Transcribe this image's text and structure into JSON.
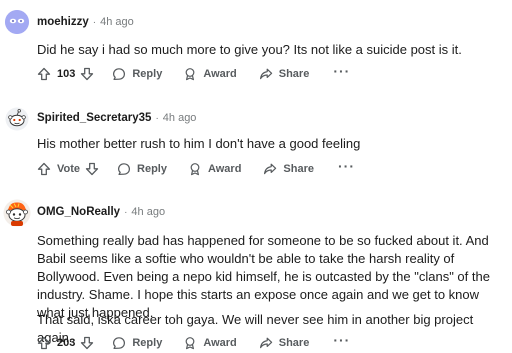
{
  "comments": [
    {
      "username": "moehizzy",
      "separator": "·",
      "time": "4h ago",
      "paragraphs": [
        "Did he say i had so much more to give you? Its not like a suicide post is it."
      ],
      "vote_label": "103",
      "reply": "Reply",
      "award": "Award",
      "share": "Share",
      "more": "···"
    },
    {
      "username": "Spirited_Secretary35",
      "separator": "·",
      "time": "4h ago",
      "paragraphs": [
        "His mother better rush to him I don't have a good feeling"
      ],
      "vote_label": "Vote",
      "reply": "Reply",
      "award": "Award",
      "share": "Share",
      "more": "···"
    },
    {
      "username": "OMG_NoReally",
      "separator": "·",
      "time": "4h ago",
      "paragraphs": [
        "Something really bad has happened for someone to be so fucked about it. And Babil seems like a softie who wouldn't be able to take the harsh reality of Bollywood. Even being a nepo kid himself, he is outcasted by the \"clans\" of the industry. Shame. I hope this starts an expose once again and we get to know what just happened.",
        "That said, iska career toh gaya. We will never see him in another big project again."
      ],
      "vote_label": "203",
      "reply": "Reply",
      "award": "Award",
      "share": "Share",
      "more": "···"
    }
  ],
  "colors": {
    "avatar1": "#a3a9f3",
    "text": "#1c1c1c",
    "meta": "#787c7e",
    "action": "#575b5e"
  },
  "icons": [
    "upvote-icon",
    "downvote-icon",
    "reply-bubble-icon",
    "award-icon",
    "share-arrow-icon",
    "more-dots-icon"
  ]
}
